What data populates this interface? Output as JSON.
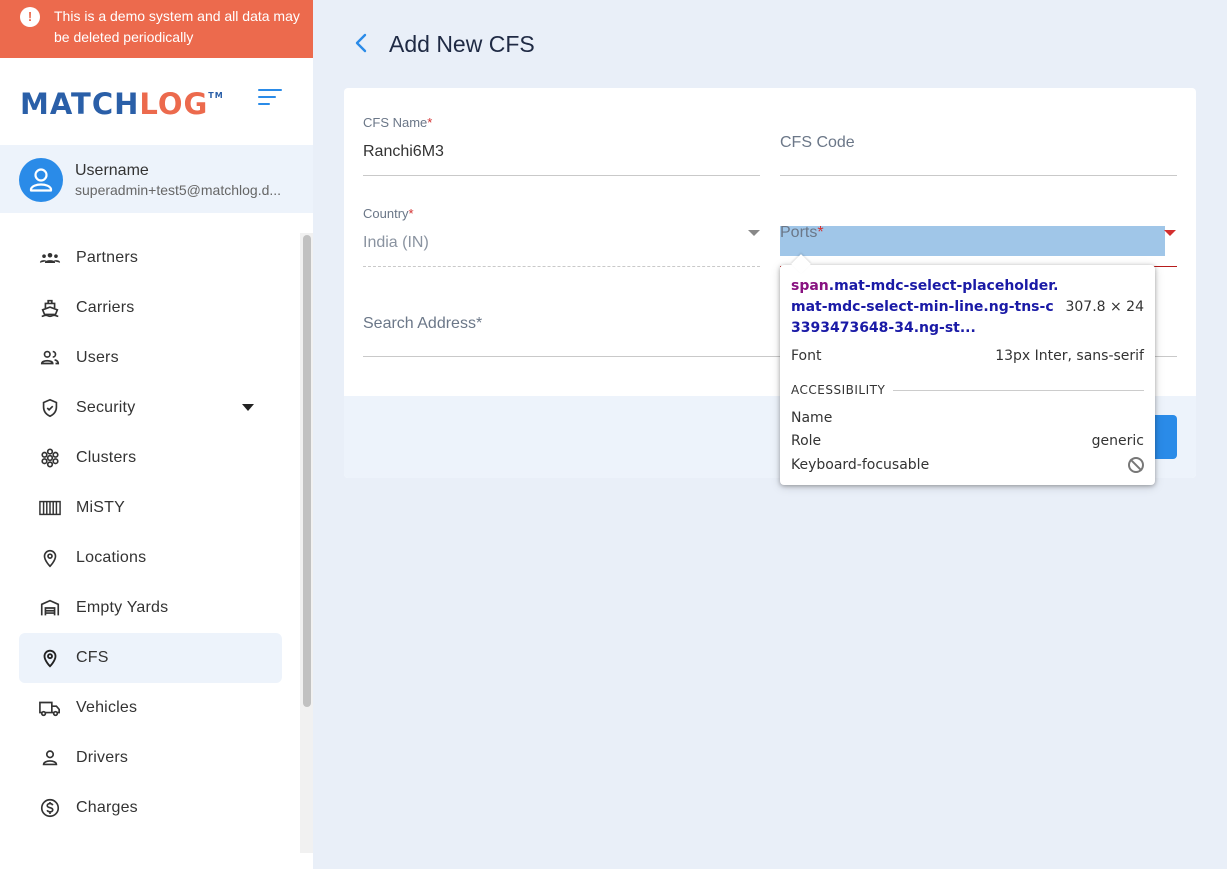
{
  "banner": {
    "text": "This is a demo system and all data may be deleted periodically"
  },
  "brand": {
    "part1": "MATCH",
    "part2": "LOG",
    "tm": "TM"
  },
  "user": {
    "name": "Username",
    "email": "superadmin+test5@matchlog.d..."
  },
  "nav": {
    "items": [
      {
        "label": "Partners",
        "icon": "partners-icon"
      },
      {
        "label": "Carriers",
        "icon": "ship-icon"
      },
      {
        "label": "Users",
        "icon": "users-icon"
      },
      {
        "label": "Security",
        "icon": "shield-icon"
      },
      {
        "label": "Clusters",
        "icon": "cluster-icon"
      },
      {
        "label": "MiSTY",
        "icon": "container-icon"
      },
      {
        "label": "Locations",
        "icon": "location-pin-icon"
      },
      {
        "label": "Empty Yards",
        "icon": "warehouse-icon"
      },
      {
        "label": "CFS",
        "icon": "location-pin-icon"
      },
      {
        "label": "Vehicles",
        "icon": "truck-icon"
      },
      {
        "label": "Drivers",
        "icon": "person-icon"
      },
      {
        "label": "Charges",
        "icon": "dollar-icon"
      }
    ],
    "active": "CFS"
  },
  "page": {
    "title": "Add New CFS"
  },
  "form": {
    "cfs_name_label": "CFS Name",
    "cfs_name_value": "Ranchi6M3",
    "cfs_code_placeholder": "CFS Code",
    "country_label": "Country",
    "country_value": "India (IN)",
    "ports_placeholder": "Ports",
    "search_address_placeholder": "Search Address",
    "required_mark": "*"
  },
  "devtools_tooltip": {
    "tag": "span",
    "selector": ".mat-mdc-select-placeholder.mat-mdc-select-min-line.ng-tns-c3393473648-34.ng-st...",
    "size": "307.8 × 24",
    "font_label": "Font",
    "font_value": "13px Inter, sans-serif",
    "section": "ACCESSIBILITY",
    "name_label": "Name",
    "name_value": "",
    "role_label": "Role",
    "role_value": "generic",
    "focus_label": "Keyboard-focusable"
  },
  "colors": {
    "accent": "#2a8be8",
    "brand_blue": "#2a5fa8",
    "brand_orange": "#ec6a4d",
    "required": "#d32f2f"
  }
}
